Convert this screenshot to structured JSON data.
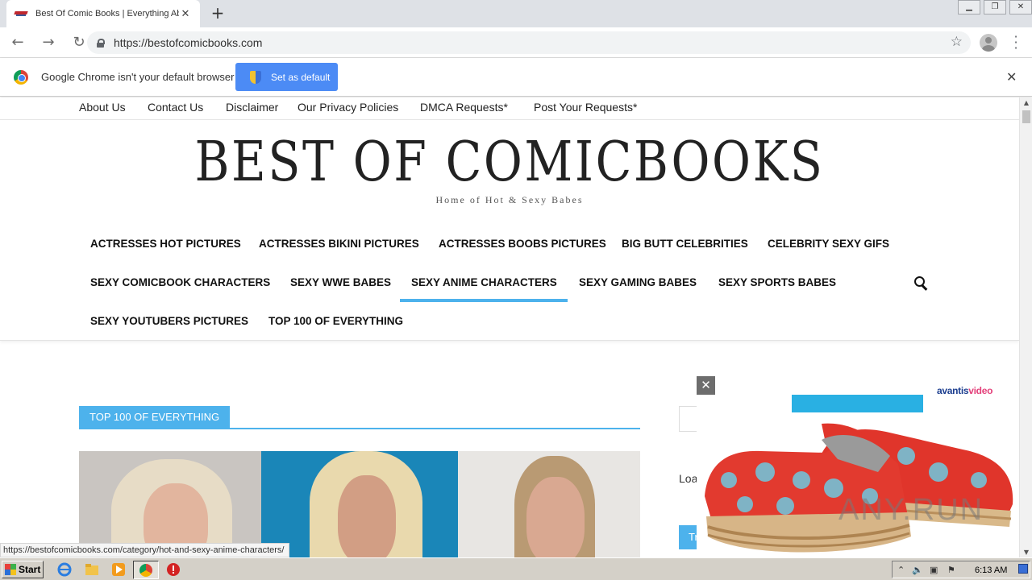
{
  "browser": {
    "tab_title": "Best Of Comic Books | Everything Ab",
    "tab_close": "✕",
    "new_tab": "+",
    "url": "https://bestofcomicbooks.com",
    "infobar_text": "Google Chrome isn't your default browser",
    "set_default_label": "Set as default",
    "infobar_close": "✕",
    "status_url": "https://bestofcomicbooks.com/category/hot-and-sexy-anime-characters/"
  },
  "site": {
    "top_links": [
      "About Us",
      "Contact Us",
      "Disclaimer",
      "Our Privacy Policies",
      "DMCA Requests*",
      "Post Your Requests*"
    ],
    "title": "BEST OF COMICBOOKS",
    "subtitle": "Home of Hot & Sexy Babes",
    "menu": [
      "ACTRESSES HOT PICTURES",
      "ACTRESSES BIKINI PICTURES",
      "ACTRESSES BOOBS PICTURES",
      "BIG BUTT CELEBRITIES",
      "CELEBRITY SEXY GIFS",
      "SEXY COMICBOOK CHARACTERS",
      "SEXY WWE BABES",
      "SEXY ANIME CHARACTERS",
      "SEXY GAMING BABES",
      "SEXY SPORTS BABES",
      "SEXY YOUTUBERS PICTURES",
      "TOP 100 OF EVERYTHING"
    ],
    "active_menu": "SEXY ANIME CHARACTERS",
    "section_title": "TOP 100 OF EVERYTHING",
    "sidebar_loading": "Loa",
    "sidebar_button": "Tr"
  },
  "ad": {
    "close": "✕",
    "brand_a": "avantis",
    "brand_b": "video",
    "watermark": "ANY.RUN"
  },
  "taskbar": {
    "start_label": "Start",
    "clock": "6:13 AM"
  },
  "colors": {
    "accent": "#4db2ec",
    "chrome_blue": "#4c8bf5",
    "tab_strip": "#dee1e6"
  }
}
